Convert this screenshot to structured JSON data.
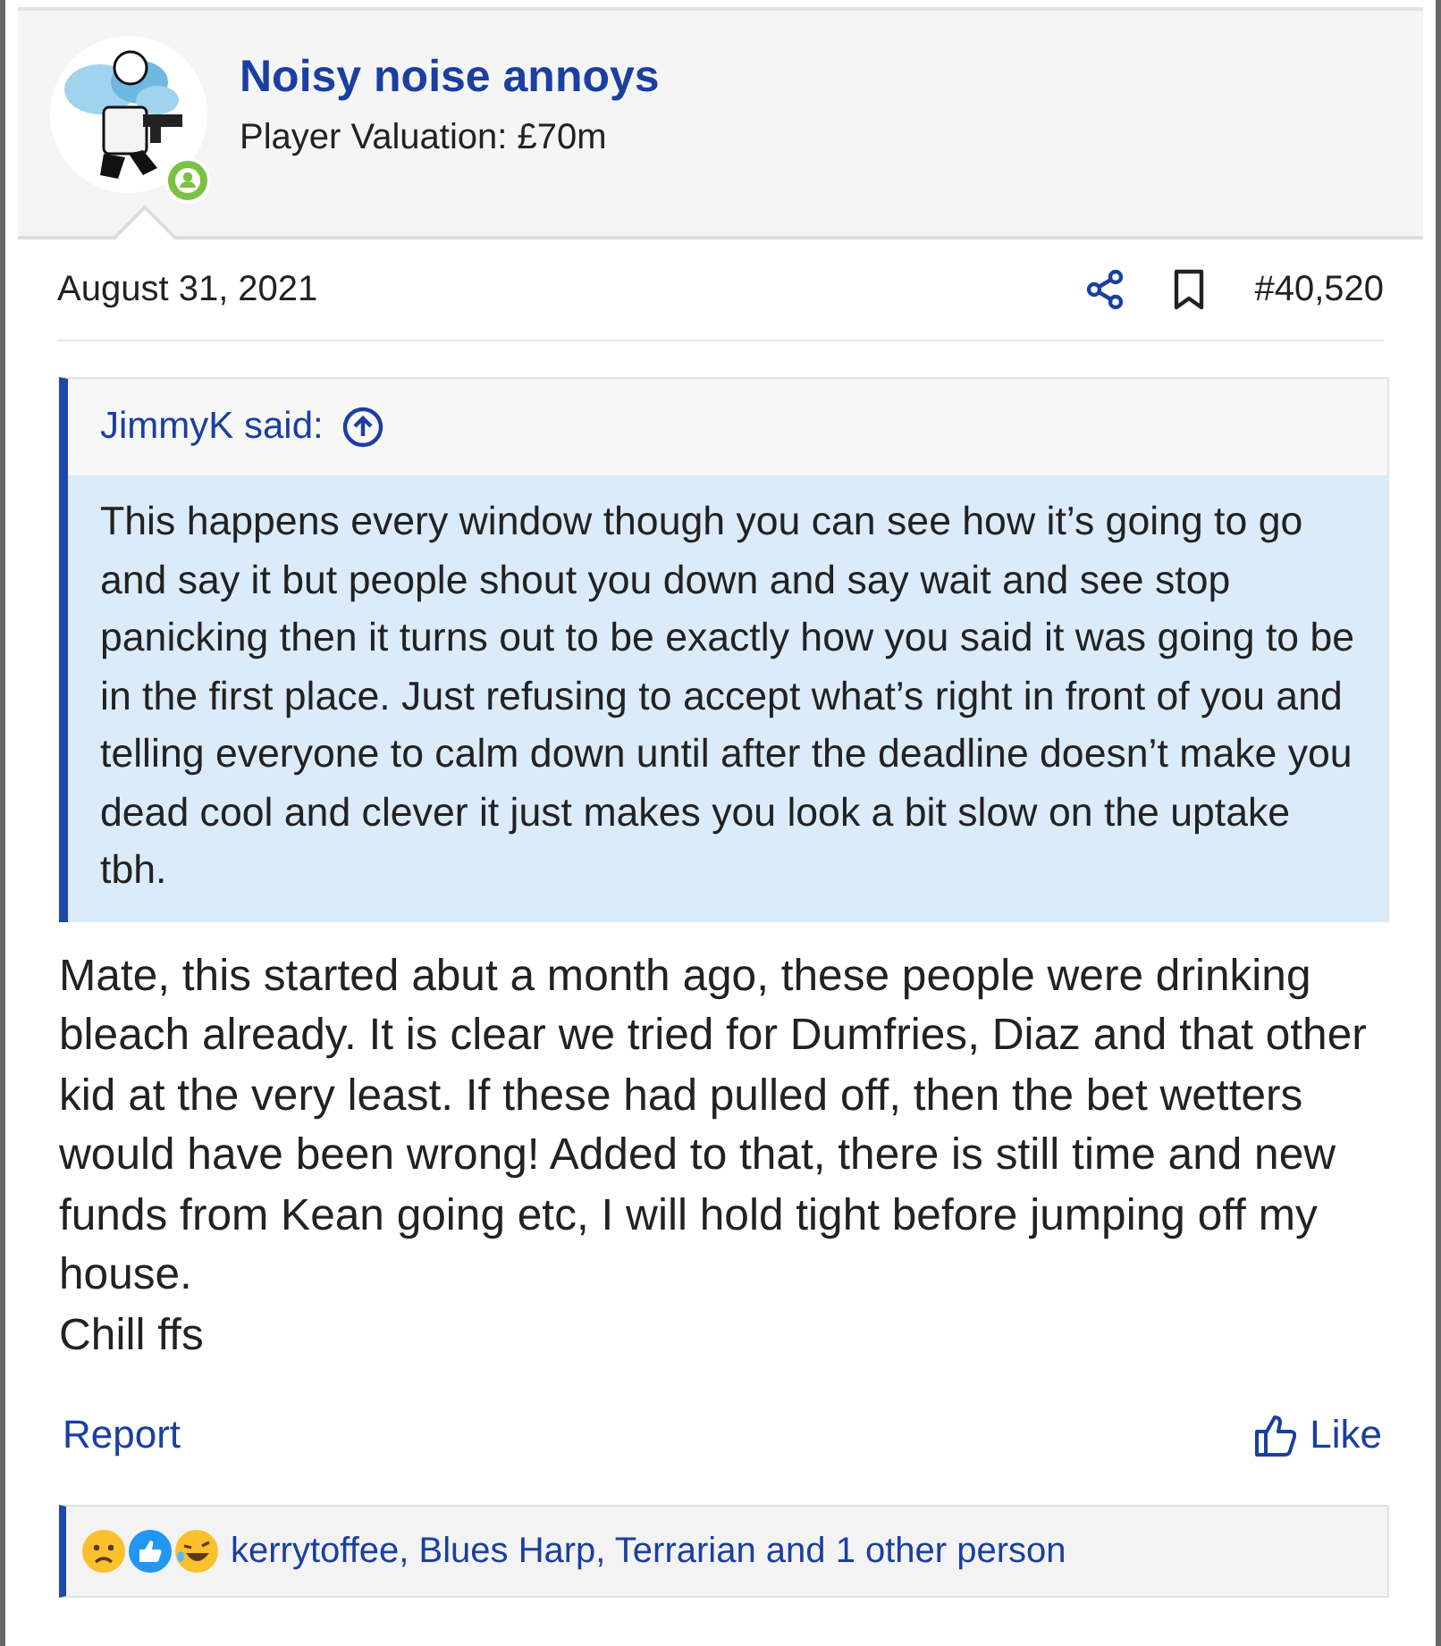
{
  "author": {
    "name": "Noisy noise annoys",
    "title": "Player Valuation: £70m",
    "online": true
  },
  "post": {
    "date": "August 31, 2021",
    "number": "#40,520",
    "bookmarked": false
  },
  "quote": {
    "author": "JimmyK said:",
    "text": "This happens every window though you can see how it’s going to go and say it but people shout you down and say wait and see stop panicking then it turns out to be exactly how you said it was going to be in the first place. Just refusing to accept what’s right in front of you and telling everyone to calm down until after the deadline doesn’t make you dead cool and clever it just makes you look a bit slow on the uptake tbh."
  },
  "body": [
    "Mate, this started abut a month ago, these people were drinking bleach already. It is clear we tried for Dumfries, Diaz and that other kid at the very least. If these had pulled off, then the bet wetters would have been wrong! Added to that, there is still time and new funds from Kean going etc, I will hold tight before jumping off my house.",
    "Chill ffs"
  ],
  "actions": {
    "report": "Report",
    "like": "Like"
  },
  "reactions": {
    "text": "kerrytoffee, Blues Harp, Terrarian and 1 other person"
  }
}
